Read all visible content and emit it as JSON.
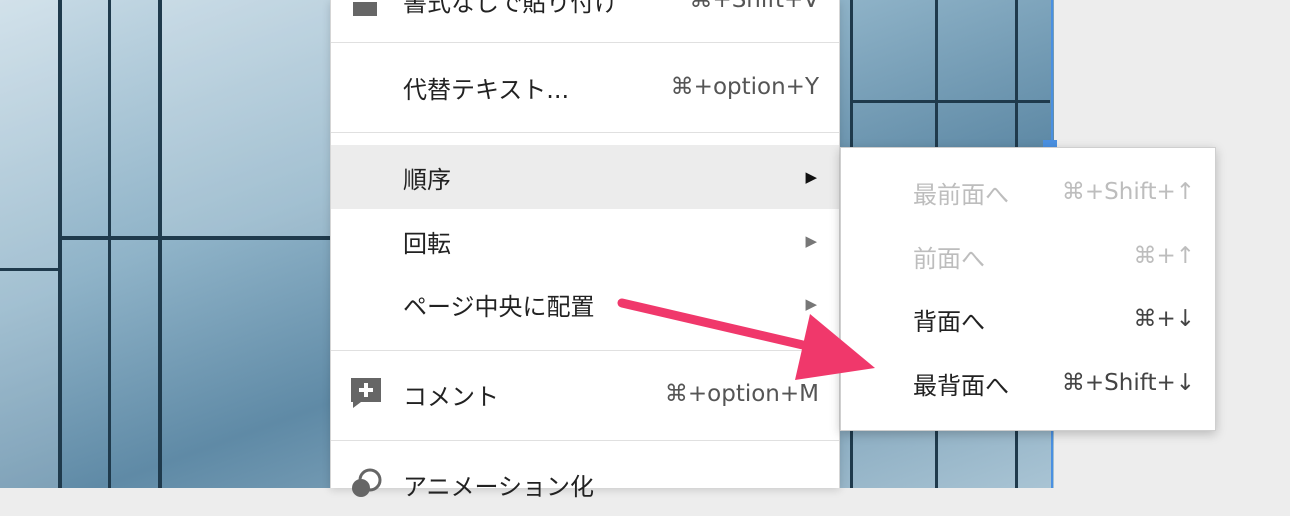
{
  "context_menu": {
    "items": [
      {
        "label": "書式なしで貼り付け",
        "shortcut": "⌘+Shift+V",
        "partial": true
      },
      {
        "label": "代替テキスト...",
        "shortcut": "⌘+option+Y"
      },
      {
        "label": "順序",
        "arrow": "▶",
        "active": true
      },
      {
        "label": "回転",
        "arrow": "▶"
      },
      {
        "label": "ページ中央に配置",
        "arrow": "▶"
      },
      {
        "label": "コメント",
        "shortcut": "⌘+option+M",
        "icon": "add-comment-icon"
      },
      {
        "label": "アニメーション化",
        "icon": "animation-icon",
        "partial": true
      }
    ]
  },
  "submenu": {
    "parent": "順序",
    "items": [
      {
        "label": "最前面へ",
        "shortcut": "⌘+Shift+↑",
        "disabled": true
      },
      {
        "label": "前面へ",
        "shortcut": "⌘+↑",
        "disabled": true
      },
      {
        "label": "背面へ",
        "shortcut": "⌘+↓",
        "disabled": false
      },
      {
        "label": "最背面へ",
        "shortcut": "⌘+Shift+↓",
        "disabled": false
      }
    ]
  },
  "colors": {
    "callout_arrow": "#f0386b",
    "selection": "#4a90e2",
    "hover_background": "#ececec"
  }
}
